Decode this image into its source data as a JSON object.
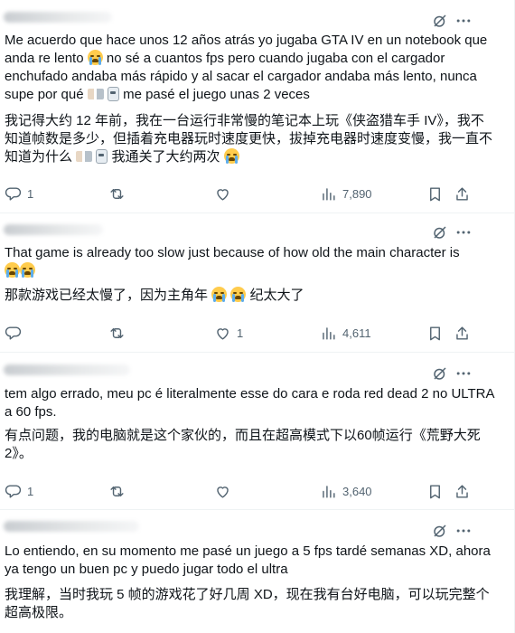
{
  "posts": [
    {
      "text": "Me acuerdo que hace unos 12 años atrás yo jugaba GTA IV en un notebook que anda re lento",
      "text_b": " no sé a cuantos fps pero cuando jugaba con el cargador enchufado andaba más rápido y al sacar el cargador andaba más lento, nunca supe por qué",
      "text_c": " me pasé el juego unas 2 veces",
      "translation": "我记得大约 12 年前，我在一台运行非常慢的笔记本上玩《侠盗猎车手 IV》，我不知道帧数是多少，但插着充电器玩时速度更快，拔掉充电器时速度变慢，我一直不知道为什么",
      "translation_b": "我通关了大约两次",
      "replies": "1",
      "reposts": "",
      "likes": "",
      "views": "7,890"
    },
    {
      "text": "That game is already too slow just because of how old the main character is",
      "translation": "那款游戏已经太慢了，因为主角年",
      "translation_b": "纪太大了",
      "replies": "",
      "reposts": "",
      "likes": "1",
      "views": "4,611"
    },
    {
      "text": "tem algo errado, meu pc é literalmente esse do cara e roda red dead 2 no ULTRA a 60 fps.",
      "translation": "有点问题，我的电脑就是这个家伙的，而且在超高模式下以60帧运行《荒野大死2》。",
      "replies": "1",
      "reposts": "",
      "likes": "",
      "views": "3,640"
    },
    {
      "text": "Lo entiendo, en su momento me pasé un juego a 5 fps tardé semanas XD, ahora ya tengo un buen pc y puedo jugar todo el ultra",
      "translation": "我理解，当时我玩 5 帧的游戏花了好几周 XD，现在我有台好电脑，可以玩完整个超高极限。"
    }
  ],
  "icons": {
    "grok": "grok-icon",
    "more": "more-icon",
    "reply": "reply-icon",
    "repost": "repost-icon",
    "like": "like-icon",
    "views": "views-icon",
    "bookmark": "bookmark-icon",
    "share": "share-icon",
    "loudly_crying": "loudly-crying-face-emoji"
  },
  "colors": {
    "text": "#0f1419",
    "secondary": "#536471",
    "border": "#eff3f4"
  }
}
